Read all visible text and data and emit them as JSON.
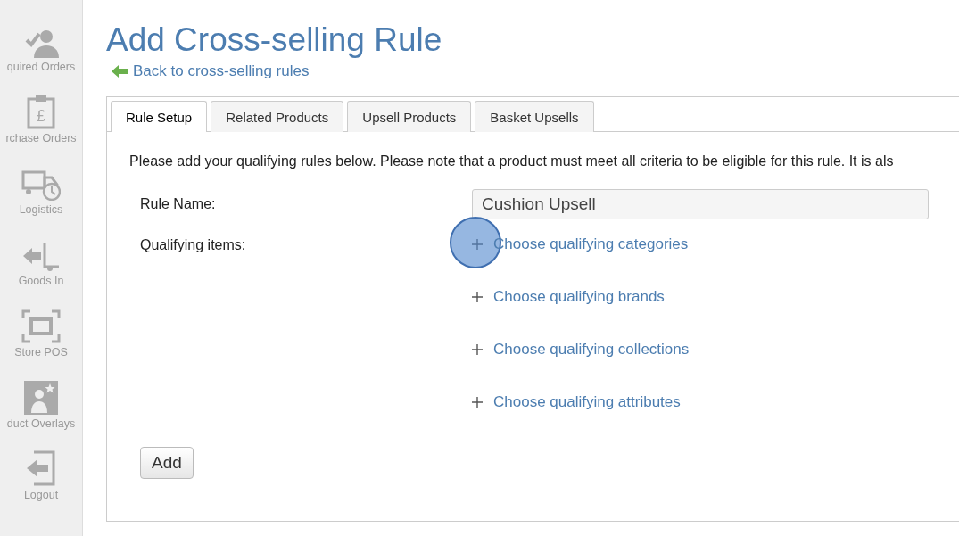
{
  "sidebar": {
    "items": [
      {
        "label": "quired Orders",
        "kind": "people"
      },
      {
        "label": "rchase Orders",
        "kind": "clipboard",
        "symbol": "£"
      },
      {
        "label": "Logistics",
        "kind": "truck"
      },
      {
        "label": "Goods In",
        "kind": "trolley"
      },
      {
        "label": "Store POS",
        "kind": "screen"
      },
      {
        "label": "duct Overlays",
        "kind": "overlay"
      },
      {
        "label": "Logout",
        "kind": "logout"
      }
    ]
  },
  "page": {
    "title": "Add Cross-selling Rule",
    "back_link": "Back to cross-selling rules"
  },
  "tabs": [
    {
      "label": "Rule Setup",
      "selected": true
    },
    {
      "label": "Related Products",
      "selected": false
    },
    {
      "label": "Upsell Products",
      "selected": false
    },
    {
      "label": "Basket Upsells",
      "selected": false
    }
  ],
  "form": {
    "intro": "Please add your qualifying rules below. Please note that a product must meet all criteria to be eligible for this rule. It is als",
    "rule_name": {
      "label": "Rule Name:",
      "value": "Cushion Upsell"
    },
    "qualifying": {
      "label": "Qualifying items:",
      "links": [
        {
          "label": "Choose qualifying categories",
          "highlighted": true
        },
        {
          "label": "Choose qualifying brands",
          "highlighted": false
        },
        {
          "label": "Choose qualifying collections",
          "highlighted": false
        },
        {
          "label": "Choose qualifying attributes",
          "highlighted": false
        }
      ]
    },
    "add_button": "Add"
  }
}
